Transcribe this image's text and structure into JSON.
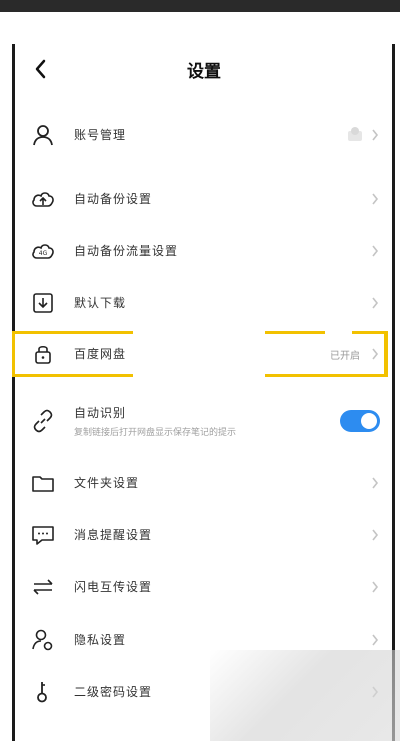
{
  "header": {
    "title": "设置"
  },
  "items": [
    {
      "label": "账号管理"
    },
    {
      "label": "自动备份设置"
    },
    {
      "label": "自动备份流量设置"
    },
    {
      "label": "默认下载"
    },
    {
      "label": "百度网盘",
      "status": "已开启"
    },
    {
      "label": "自动识别",
      "sub": "复制链接后打开网盘显示保存笔记的提示"
    },
    {
      "label": "文件夹设置"
    },
    {
      "label": "消息提醒设置"
    },
    {
      "label": "闪电互传设置"
    },
    {
      "label": "隐私设置"
    },
    {
      "label": "二级密码设置"
    }
  ],
  "icons": {
    "back": "chevron-left-icon",
    "account": "user-icon",
    "auto_backup": "cloud-upload-icon",
    "backup_traffic": "cloud-4g-icon",
    "download": "download-icon",
    "lock": "lock-icon",
    "link": "link-icon",
    "folder": "folder-icon",
    "message": "message-icon",
    "transfer": "transfer-arrows-icon",
    "privacy": "privacy-user-icon",
    "password": "key-icon"
  },
  "colors": {
    "accent": "#2d8cf0",
    "highlight": "#f2c100"
  },
  "toggle": {
    "auto_recognize_on": true
  }
}
